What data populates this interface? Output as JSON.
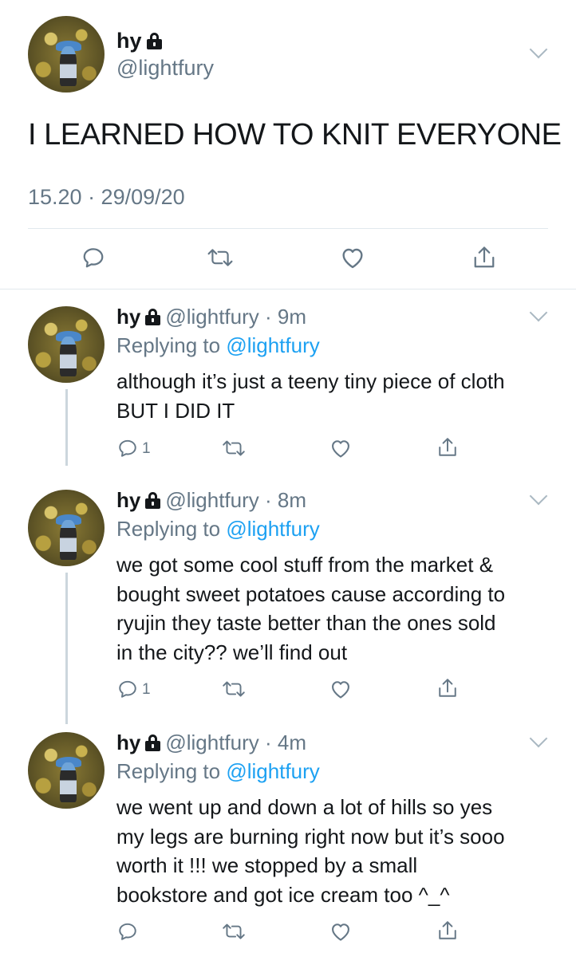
{
  "main_tweet": {
    "name": "hy",
    "handle": "@lightfury",
    "text": "I LEARNED HOW TO KNIT EVERYONE",
    "timestamp": "15.20 · 29/09/20"
  },
  "replies": [
    {
      "name": "hy",
      "handle": "@lightfury",
      "time": "9m",
      "replying_prefix": "Replying to ",
      "replying_to": "@lightfury",
      "text_lines": [
        "although it’s just a teeny tiny piece of cloth",
        "BUT I DID IT"
      ],
      "reply_count": "1"
    },
    {
      "name": "hy",
      "handle": "@lightfury",
      "time": "8m",
      "replying_prefix": "Replying to ",
      "replying_to": "@lightfury",
      "text_lines": [
        "we got some cool stuff from the market &",
        "bought sweet potatoes cause according to",
        "ryujin they taste better than the ones sold",
        "in the city?? we’ll find out"
      ],
      "reply_count": "1"
    },
    {
      "name": "hy",
      "handle": "@lightfury",
      "time": "4m",
      "replying_prefix": "Replying to ",
      "replying_to": "@lightfury",
      "text_lines": [
        "we went up and down a lot of hills so yes",
        "my legs are burning right now but it’s sooo",
        "worth it !!! we stopped by a small",
        "bookstore and got ice cream too ^_^"
      ],
      "reply_count": ""
    }
  ],
  "icons": [
    "reply-icon",
    "retweet-icon",
    "like-icon",
    "share-icon",
    "lock-icon",
    "chevron-down-icon",
    "avatar"
  ],
  "colors": {
    "link": "#1da1f2",
    "secondary_text": "#657786",
    "icon": "#657786",
    "divider": "#e1e8ed"
  }
}
